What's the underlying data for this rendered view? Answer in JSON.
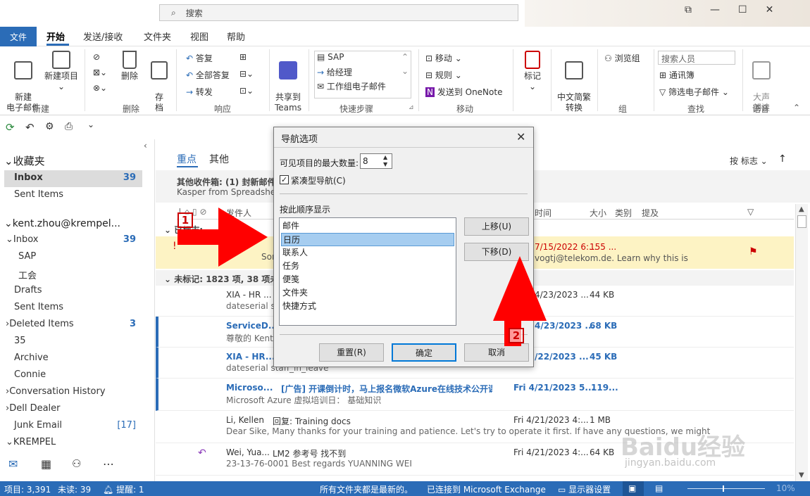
{
  "title": {
    "search_label": "搜索"
  },
  "ribbon": {
    "tabs": [
      "文件",
      "开始",
      "发送/接收",
      "文件夹",
      "视图",
      "帮助"
    ],
    "new_email": "新建\n电子邮件",
    "new_items": "新建项目",
    "delete": "删除",
    "archive": "存\n档",
    "reply": "答复",
    "reply_all": "全部答复",
    "forward": "转发",
    "share_teams": "共享到\nTeams",
    "qs_sap": "SAP",
    "qs_manager": "给经理",
    "qs_team": "工作组电子邮件",
    "move": "移动",
    "rules": "规则",
    "onenote": "发送到 OneNote",
    "tag": "标记",
    "zh_convert": "中文简繁\n转换",
    "browse_group": "浏览组",
    "search_people": "搜索人员",
    "address_book": "通讯簿",
    "filter_email": "筛选电子邮件",
    "read_aloud": "大声\n朗读",
    "groups": [
      "新建",
      "删除",
      "响应",
      "Teams",
      "快速步骤",
      "移动",
      "组",
      "查找",
      "语音"
    ]
  },
  "nav": {
    "favorites": "收藏夹",
    "fav_items": [
      {
        "label": "Inbox",
        "count": "39"
      },
      {
        "label": "Sent Items",
        "count": ""
      }
    ],
    "account": "kent.zhou@krempel...",
    "folders": [
      {
        "label": "Inbox",
        "count": "39"
      },
      {
        "label": "SAP",
        "count": ""
      },
      {
        "label": "工会",
        "count": ""
      },
      {
        "label": "Drafts",
        "count": ""
      },
      {
        "label": "Sent Items",
        "count": ""
      },
      {
        "label": "Deleted Items",
        "count": "3"
      },
      {
        "label": "35",
        "count": ""
      },
      {
        "label": "Archive",
        "count": ""
      },
      {
        "label": "Connie",
        "count": ""
      },
      {
        "label": "Conversation History",
        "count": ""
      },
      {
        "label": "Dell Dealer",
        "count": ""
      },
      {
        "label": "Junk Email",
        "count": "[17]"
      },
      {
        "label": "KREMPEL",
        "count": ""
      }
    ]
  },
  "mail": {
    "tab_focused": "重点",
    "tab_other": "其他",
    "sort": "按 标志",
    "other_inbox": "其他收件箱: (1) 封新邮件",
    "other_from": "Kasper from Spreadshe",
    "col_from": "发件人",
    "col_received": "时间",
    "col_size": "大小",
    "col_category": "类别",
    "col_mention": "提及",
    "group_flagged": "已标志:",
    "flagged_date": "7/15/2022 6:...",
    "flagged_size": "155 ...",
    "flagged_sender": "Sor",
    "flagged_preview": "vogtj@telekom.de. Learn why this is",
    "group_unflagged": "未标记: 1823 项, 38 项未",
    "rows": [
      {
        "from": "XIA - HR ...",
        "preview": "dateserial s",
        "date": "4/23/2023 ...",
        "size": "44 KB",
        "unread": false
      },
      {
        "from": "ServiceD...",
        "preview": "尊敬的 Kent",
        "date": "4/23/2023 ...",
        "size": "68 KB",
        "unread": true
      },
      {
        "from": "XIA - HR...",
        "preview": "dateserial staff_in_leave",
        "date": "/22/2023 ...",
        "size": "45 KB",
        "unread": true
      },
      {
        "from": "Microso...",
        "subject": "[广告] 开课倒计时，马上报名微软Azure在线技术公开课",
        "preview": "Microsoft Azure 虚拟培训日：  基础知识",
        "date": "Fri 4/21/2023 5...",
        "size": "119...",
        "unread": true
      },
      {
        "from": "Li, Kellen",
        "subject": "回复: Training docs",
        "preview": "Dear Sike,     Many thanks for your training and patience.   Let's try to operate it first.   If have any questions, we might",
        "date": "Fri 4/21/2023 4:...",
        "size": "1 MB",
        "unread": false
      },
      {
        "from": "Wei, Yua...",
        "subject": "LM2  参考号   找不到",
        "preview": "23-13-76-0001  Best regards    YUANNING WEI",
        "date": "Fri 4/21/2023 4:...",
        "size": "64 KB",
        "unread": false
      }
    ]
  },
  "dialog": {
    "title": "导航选项",
    "max_label": "可见项目的最大数量:",
    "max_value": "8",
    "compact_label": "紧凑型导航(C)",
    "order_label": "按此顺序显示",
    "items": [
      "邮件",
      "日历",
      "联系人",
      "任务",
      "便笺",
      "文件夹",
      "快捷方式"
    ],
    "selected_index": 1,
    "move_up": "上移(U)",
    "move_down": "下移(D)",
    "reset": "重置(R)",
    "ok": "确定",
    "cancel": "取消"
  },
  "status": {
    "items": "项目: 3,391",
    "unread": "未读: 39",
    "reminders": "提醒: 1",
    "uptodate": "所有文件夹都是最新的。",
    "connected": "已连接到 Microsoft Exchange",
    "display": "显示器设置",
    "zoom": "10%"
  },
  "annotations": {
    "one": "1",
    "two": "2"
  },
  "watermark": {
    "text": "Baidu经验",
    "url": "jingyan.baidu.com"
  },
  "colors": {
    "accent": "#2b6cb7",
    "flag_bg": "#fdf3c4",
    "annotation": "#ff0000"
  }
}
